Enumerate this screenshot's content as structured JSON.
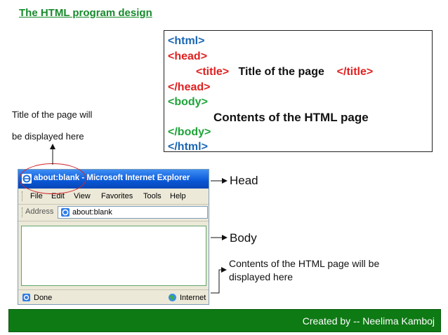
{
  "slide": {
    "title": "The HTML program design"
  },
  "code": {
    "html_open": "<html>",
    "head_open": "<head>",
    "title_open": "<title>",
    "title_text": "Title of the page",
    "title_close": "</title>",
    "head_close": "</head>",
    "body_open": "<body>",
    "body_text": "Contents of the HTML page",
    "body_close": "</body>",
    "html_close": "</html>"
  },
  "note": {
    "line1": "Title of the page will",
    "line2": "be displayed here"
  },
  "browser": {
    "window_title": "about:blank - Microsoft Internet Explorer",
    "menu": [
      "File",
      "Edit",
      "View",
      "Favorites",
      "Tools",
      "Help"
    ],
    "address_label": "Address",
    "address_value": "about:blank",
    "status_left": "Done",
    "status_right": "Internet"
  },
  "callouts": {
    "head": "Head",
    "body": "Body",
    "contents_line1": "Contents of the HTML page will be",
    "contents_line2": "displayed here"
  },
  "footer": {
    "credit": "Created by  --  Neelima Kamboj"
  },
  "colors": {
    "title_green": "#178a2b",
    "tag_blue": "#1a66b3",
    "tag_red": "#e02020",
    "tag_green": "#1fa33a",
    "footer_green": "#0e7a14",
    "ellipse_red": "#d0262a"
  },
  "icons": [
    "ie-icon",
    "done-page-icon",
    "internet-globe-icon",
    "arrow-icon"
  ]
}
